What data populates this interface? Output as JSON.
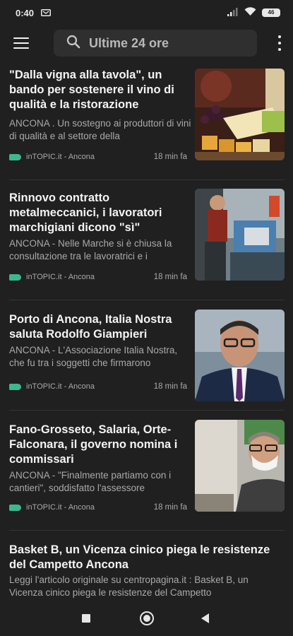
{
  "status_bar": {
    "time": "0:40",
    "battery": "46"
  },
  "header": {
    "search_label": "Ultime 24 ore",
    "icons": [
      "menu-icon",
      "search-icon",
      "more-vert-icon"
    ]
  },
  "articles": [
    {
      "title": "\"Dalla vigna alla tavola\", un bando per sostenere il vino di qualità e la ristorazione",
      "summary": "ANCONA . Un sostegno ai produttori di vini di qualità e al settore della",
      "source": "inTOPIC.it - Ancona",
      "time": "18 min fa"
    },
    {
      "title": "Rinnovo contratto metalmeccanici, i lavoratori marchigiani dicono \"sì\"",
      "summary": "ANCONA - Nelle Marche si è chiusa la consultazione tra le lavoratrici e i",
      "source": "inTOPIC.it - Ancona",
      "time": "18 min fa"
    },
    {
      "title": "Porto di Ancona, Italia Nostra saluta Rodolfo Giampieri",
      "summary": "ANCONA  - L'Associazione Italia Nostra, che fu tra i soggetti che firmarono",
      "source": "inTOPIC.it - Ancona",
      "time": "18 min fa"
    },
    {
      "title": "Fano-Grosseto, Salaria, Orte-Falconara, il governo nomina i commissari",
      "summary": "ANCONA - \"Finalmente partiamo con i cantieri\", soddisfatto l'assessore",
      "source": "inTOPIC.it - Ancona",
      "time": "18 min fa"
    },
    {
      "title": "Basket B, un Vicenza cinico piega le resistenze del Campetto Ancona",
      "summary": "Leggi l'articolo originale su centropagina.it : Basket B, un Vicenza cinico piega le resistenze del Campetto"
    }
  ],
  "colors": {
    "background": "#202020",
    "search_bg": "#2f2f2f",
    "source_tag": "#3db88e"
  }
}
